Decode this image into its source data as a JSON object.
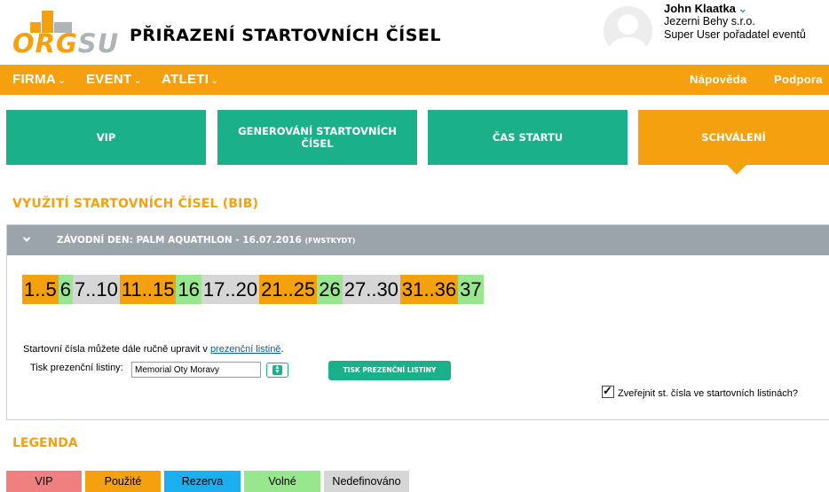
{
  "header": {
    "logo_org": "ORG",
    "logo_su": "SU",
    "page_title": "PŘIŘAZENÍ STARTOVNÍCH ČÍSEL",
    "user": {
      "name": "John Klaatka",
      "org": "Jezerni Behy s.r.o.",
      "role": "Super User pořadatel eventů"
    }
  },
  "nav": {
    "left": [
      {
        "label": "FIRMA"
      },
      {
        "label": "EVENT"
      },
      {
        "label": "ATLETI"
      }
    ],
    "right": [
      {
        "label": "Nápověda"
      },
      {
        "label": "Podpora"
      }
    ]
  },
  "tabs": [
    {
      "label": "VIP"
    },
    {
      "label": "GENEROVÁNÍ STARTOVNÍCH ČÍSEL"
    },
    {
      "label": "ČAS STARTU"
    },
    {
      "label": "SCHVÁLENÍ",
      "active": true
    }
  ],
  "section_title": "VYUŽITÍ STARTOVNÍCH ČÍSEL (BIB)",
  "race_day": {
    "title": "ZÁVODNÍ DEN: PALM AQUATHLON - 16.07.2016",
    "code": "(FWSTKYDT)",
    "bibs": [
      {
        "range": "1..5",
        "status": "used"
      },
      {
        "range": "6",
        "status": "free"
      },
      {
        "range": "7..10",
        "status": "undefined"
      },
      {
        "range": "11..15",
        "status": "used"
      },
      {
        "range": "16",
        "status": "free"
      },
      {
        "range": "17..20",
        "status": "undefined"
      },
      {
        "range": "21..25",
        "status": "used"
      },
      {
        "range": "26",
        "status": "free"
      },
      {
        "range": "27..30",
        "status": "undefined"
      },
      {
        "range": "31..36",
        "status": "used"
      },
      {
        "range": "37",
        "status": "free"
      }
    ],
    "note_text": "Startovní čísla můžete dále ručně upravit v ",
    "note_link": "prezenční listině",
    "note_end": ".",
    "print_label": "Tisk prezenční listiny:",
    "print_value": "Memorial Oty Moravy",
    "print_button": "TISK PREZENČNÍ LISTINY",
    "publish_label": "Zveřejnit st. čísla ve startovních listinách?",
    "publish_checked": true
  },
  "legend": {
    "title": "LEGENDA",
    "items": [
      {
        "label": "VIP",
        "color": "#f07f7f"
      },
      {
        "label": "Použité",
        "color": "#f5a00f"
      },
      {
        "label": "Rezerva",
        "color": "#1aafef"
      },
      {
        "label": "Volné",
        "color": "#98e68e"
      },
      {
        "label": "Nedefinováno",
        "color": "#d6d6d6"
      }
    ]
  },
  "colors": {
    "accent_orange": "#f5a00f",
    "teal": "#19b08a",
    "used": "#f5a00f",
    "free": "#98e68e",
    "undefined": "#d6d6d6",
    "panel_header": "#9aa4aa"
  }
}
